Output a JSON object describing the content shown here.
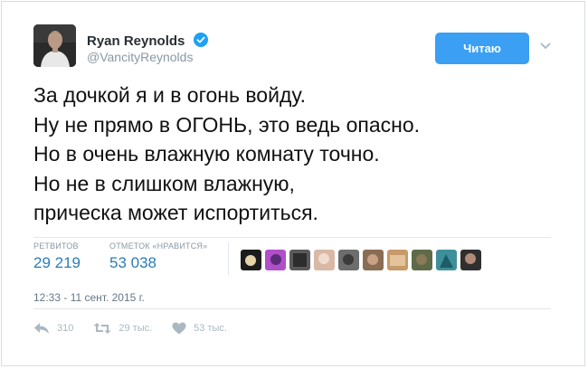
{
  "author": {
    "name": "Ryan Reynolds",
    "handle": "@VancityReynolds",
    "verified": true
  },
  "follow_button": {
    "label": "Читаю",
    "color": "#3b9ff3"
  },
  "tweet": {
    "lines": [
      "За дочкой я и в огонь войду.",
      "Ну не прямо в ОГОНЬ, это ведь опасно.",
      "Но в очень влажную комнату точно.",
      "Но не в слишком влажную,",
      "прическа может испортиться."
    ]
  },
  "stats": {
    "retweets": {
      "label": "РЕТВИТОВ",
      "value": "29 219"
    },
    "likes": {
      "label": "ОТМЕТОК «НРАВИТСЯ»",
      "value": "53 038"
    }
  },
  "likers_count_shown": 10,
  "timestamp": "12:33 - 11 сент. 2015 г.",
  "actions": {
    "reply": {
      "count": "310",
      "icon": "reply-icon"
    },
    "retweet": {
      "count": "29 тыс.",
      "icon": "retweet-icon"
    },
    "like": {
      "count": "53 тыс.",
      "icon": "heart-icon"
    }
  },
  "colors": {
    "link_blue": "#2b7bb9",
    "muted_gray": "#8899a6",
    "verified_blue": "#1da1f2"
  }
}
